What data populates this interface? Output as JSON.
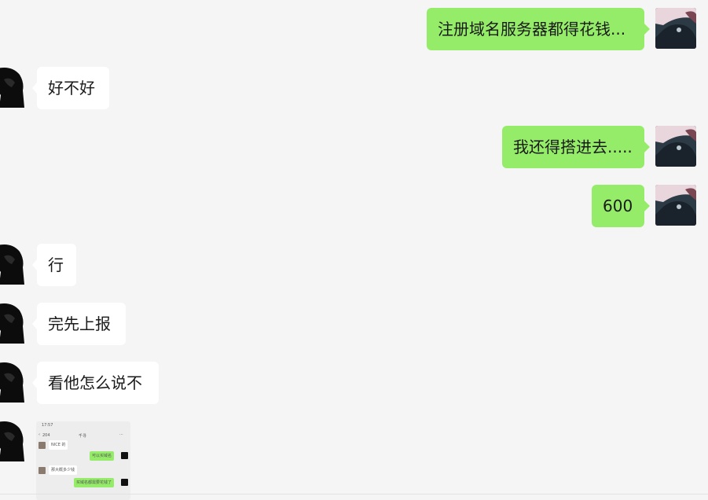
{
  "messages": [
    {
      "side": "right",
      "text": "注册域名服务器都得花钱..."
    },
    {
      "side": "left",
      "text": "好不好"
    },
    {
      "side": "right",
      "text": "我还得搭进去....."
    },
    {
      "side": "right",
      "text": "600"
    },
    {
      "side": "left",
      "text": "行"
    },
    {
      "side": "left",
      "text": "完先上报"
    },
    {
      "side": "left",
      "text": "看他怎么说不"
    }
  ],
  "image_message": {
    "time": "17:57",
    "back_count": "204",
    "contact": "千寻",
    "menu": "···",
    "rows": [
      "NICE 的",
      "可以买域名",
      "那大概多少钱",
      "买域名都需要花钱了"
    ]
  },
  "colors": {
    "background": "#f5f5f5",
    "sent_bubble": "#95ec69",
    "received_bubble": "#ffffff"
  }
}
